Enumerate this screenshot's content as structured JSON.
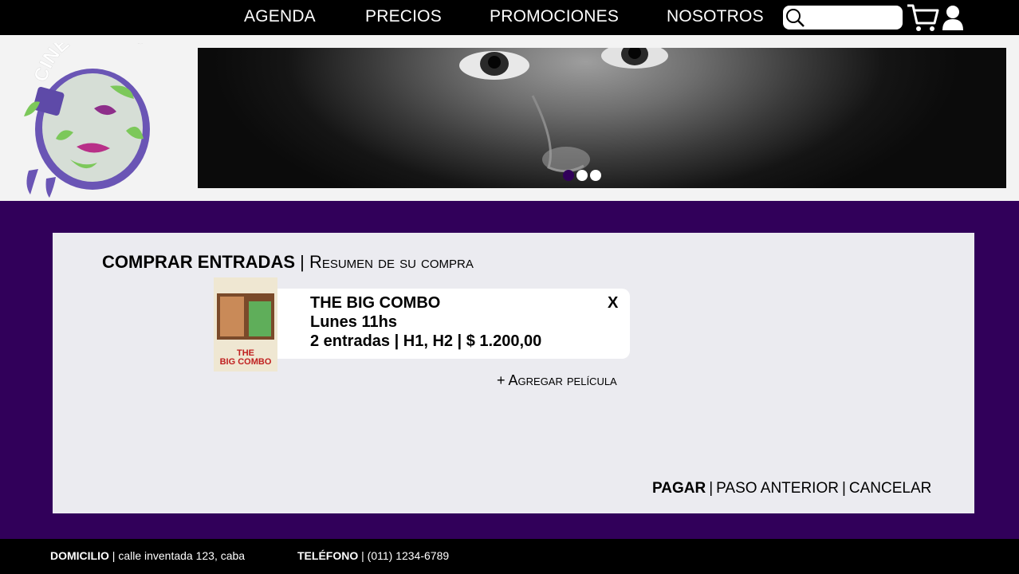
{
  "nav": {
    "items": [
      "AGENDA",
      "PRECIOS",
      "PROMOCIONES",
      "NOSOTROS"
    ],
    "search_placeholder": "",
    "icons": [
      "search-icon",
      "cart-icon",
      "user-icon"
    ]
  },
  "logo": {
    "text": "CINE MELIES"
  },
  "carousel": {
    "active_index": 0,
    "count": 3,
    "active_color": "#31005a"
  },
  "purchase": {
    "title": "COMPRAR ENTRADAS",
    "subtitle": "Resumen de su compra",
    "item": {
      "movie": "THE BIG COMBO",
      "schedule": "Lunes 11hs",
      "tickets": "2 entradas | H1, H2 | $ 1.200,00",
      "remove_label": "X"
    },
    "add_movie": "+ Agregar película",
    "actions": {
      "pay": "PAGAR",
      "previous": "PASO ANTERIOR",
      "cancel": "CANCELAR"
    }
  },
  "footer": {
    "address_label": "DOMICILIO",
    "address_value": "calle inventada 123, caba",
    "phone_label": "TELÉFONO",
    "phone_value": "(011) 1234-6789"
  },
  "colors": {
    "brand_purple": "#31005a",
    "panel": "#ebebf0"
  }
}
